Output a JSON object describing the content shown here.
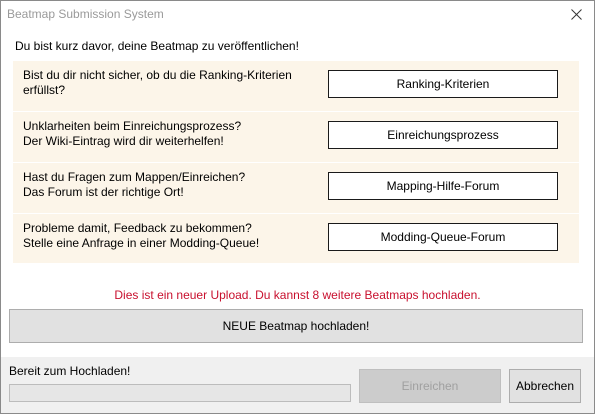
{
  "window": {
    "title": "Beatmap Submission System",
    "close_icon": "close-icon"
  },
  "intro": "Du bist kurz davor, deine Beatmap zu veröffentlichen!",
  "rows": [
    {
      "line1": "Bist du dir nicht sicher, ob du die Ranking-Kriterien",
      "line2": "erfüllst?",
      "button": "Ranking-Kriterien"
    },
    {
      "line1": "Unklarheiten beim Einreichungsprozess?",
      "line2": "Der Wiki-Eintrag wird dir weiterhelfen!",
      "button": "Einreichungsprozess"
    },
    {
      "line1": "Hast du Fragen zum Mappen/Einreichen?",
      "line2": "Das Forum ist der richtige Ort!",
      "button": "Mapping-Hilfe-Forum"
    },
    {
      "line1": "Probleme damit, Feedback zu bekommen?",
      "line2": "Stelle eine Anfrage in einer Modding-Queue!",
      "button": "Modding-Queue-Forum"
    }
  ],
  "status_message": "Dies ist ein neuer Upload. Du kannst 8 weitere Beatmaps hochladen.",
  "upload_button": "NEUE Beatmap hochladen!",
  "footer": {
    "status": "Bereit zum Hochladen!",
    "progress": 0,
    "submit_button": "Einreichen",
    "cancel_button": "Abbrechen"
  },
  "colors": {
    "panel_background": "#fcf5e9",
    "status_message": "#c8102e",
    "progress_fill": "#06b025"
  }
}
